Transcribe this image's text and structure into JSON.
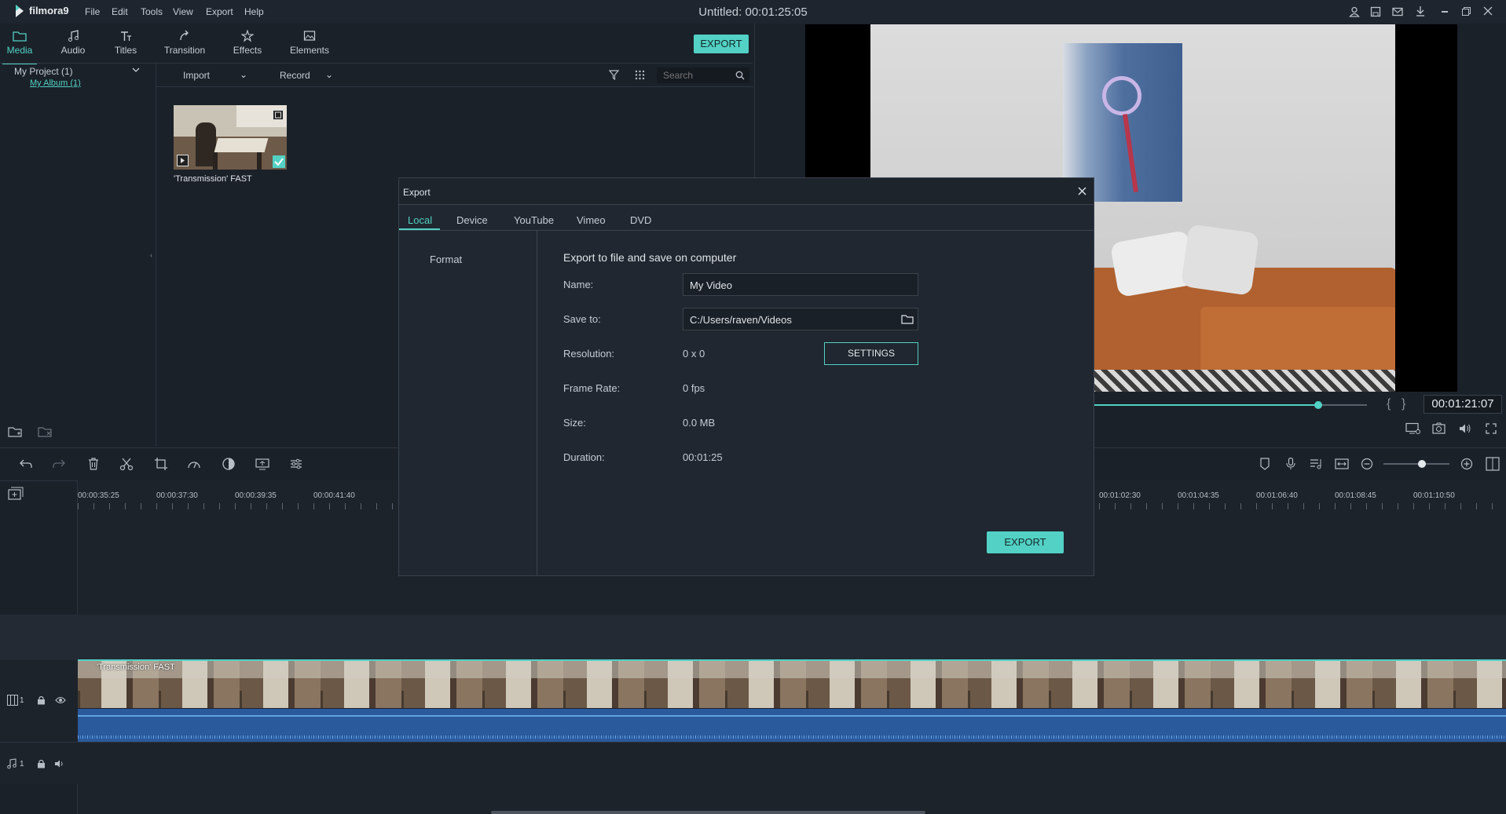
{
  "app": {
    "logo_text": "filmora9",
    "window_title": "Untitled:  00:01:25:05",
    "menu": [
      "File",
      "Edit",
      "Tools",
      "View",
      "Export",
      "Help"
    ]
  },
  "media_tabs": [
    "Media",
    "Audio",
    "Titles",
    "Transition",
    "Effects",
    "Elements"
  ],
  "toolbar": {
    "export_label": "EXPORT",
    "import_label": "Import",
    "record_label": "Record",
    "search_placeholder": "Search"
  },
  "project": {
    "root": "My Project (1)",
    "album": "My Album (1)"
  },
  "media_clip": {
    "label": "'Transmission' FAST"
  },
  "preview": {
    "timecode": "00:01:21:07",
    "progress_fraction": 0.82
  },
  "dialog": {
    "title": "Export",
    "tabs": [
      "Local",
      "Device",
      "YouTube",
      "Vimeo",
      "DVD"
    ],
    "active_tab": "Local",
    "sidebar_item": "Format",
    "heading": "Export to file and save on computer",
    "name_label": "Name:",
    "name_value": "My Video",
    "save_label": "Save to:",
    "save_value": "C:/Users/raven/Videos",
    "resolution_label": "Resolution:",
    "resolution_value": "0 x 0",
    "settings_button": "SETTINGS",
    "framerate_label": "Frame Rate:",
    "framerate_value": "0 fps",
    "size_label": "Size:",
    "size_value": "0.0 MB",
    "duration_label": "Duration:",
    "duration_value": "00:01:25",
    "export_button": "EXPORT"
  },
  "timeline": {
    "ruler_left": [
      "00:00:35:25",
      "00:00:37:30",
      "00:00:39:35",
      "00:00:41:40"
    ],
    "ruler_right": [
      "00:01:02:30",
      "00:01:04:35",
      "00:01:06:40",
      "00:01:08:45",
      "00:01:10:50"
    ],
    "video_track_label": "1",
    "audio_track_label": "1",
    "clip_label": "'Transmission' FAST",
    "zoom_fraction": 0.58
  },
  "colors": {
    "accent": "#52d1c4",
    "panel": "#1b2129",
    "dialog": "#202730",
    "audio_track": "#2b5a9c"
  }
}
